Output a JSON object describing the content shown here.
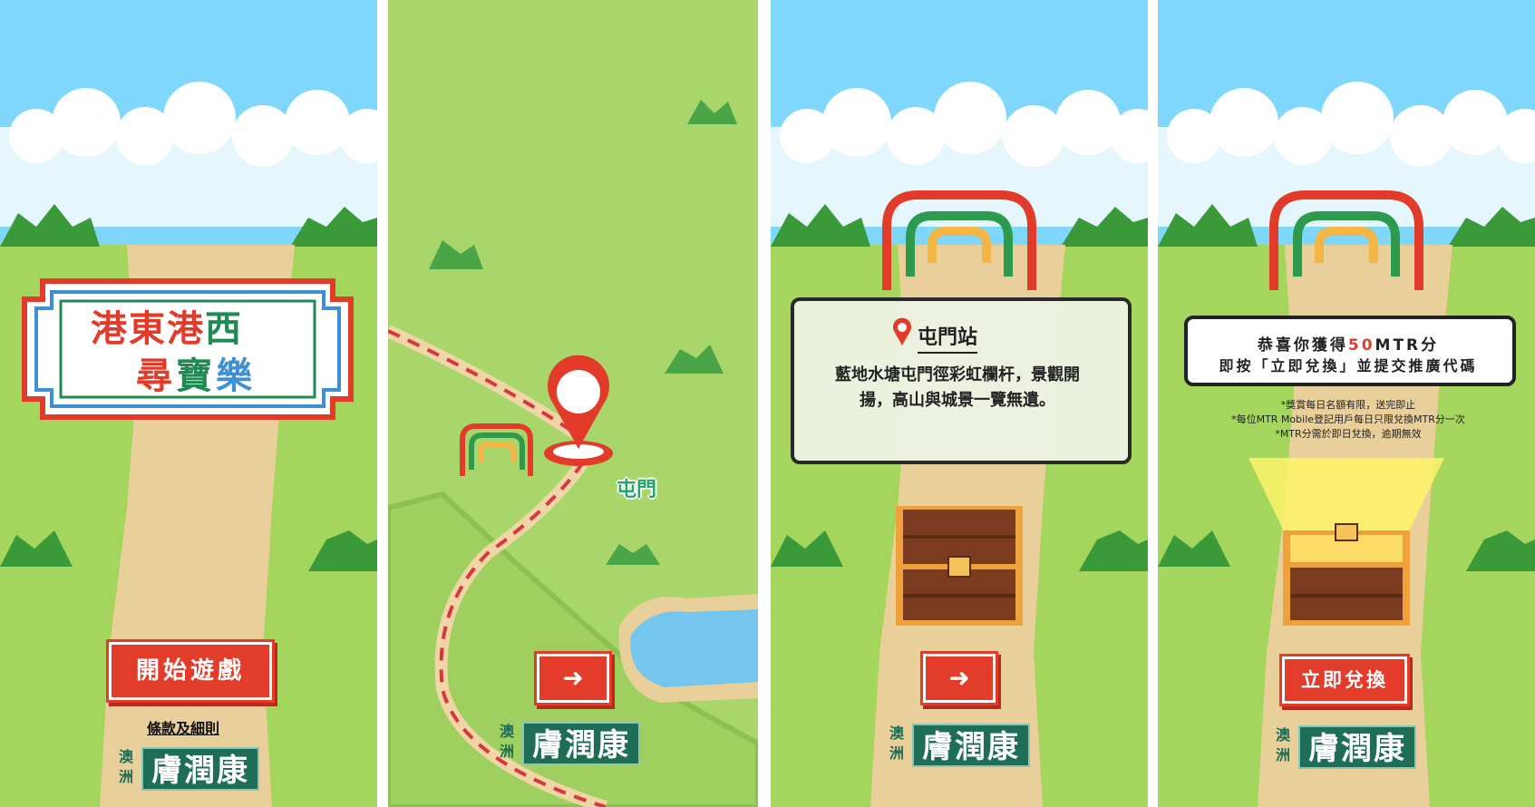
{
  "screens": {
    "start": {
      "title_line1": [
        "港",
        "東",
        "港",
        "西"
      ],
      "title_line2": [
        "尋",
        "寶",
        "樂"
      ],
      "start_button": "開始遊戲",
      "terms_link": "條款及細則"
    },
    "map": {
      "station_label": "屯門",
      "next_icon": "arrow-right-icon"
    },
    "station": {
      "station_name": "屯門站",
      "description_line1": "藍地水塘屯門徑彩虹欄杆，景觀開",
      "description_line2": "揚，高山與城景一覽無遺。",
      "next_icon": "arrow-right-icon"
    },
    "reward": {
      "congrats_prefix": "恭喜你獲得",
      "points": "50",
      "points_unit": "MTR分",
      "instruction": "即按「立即兌換」並提交推廣代碼",
      "note1": "*獎賞每日名額有限，送完即止",
      "note2": "*每位MTR Mobile登記用戶每日只限兌換MTR分一次",
      "note3": "*MTR分需於即日兌換，逾期無效",
      "redeem_button": "立即兌換"
    }
  },
  "sponsor": {
    "small_text": [
      "澳",
      "洲"
    ],
    "brand": "膚潤康"
  },
  "colors": {
    "sky": "#7fd7fb",
    "grass": "#a4d65e",
    "path": "#e9cf9a",
    "red": "#e43c2b",
    "green": "#1f8a52",
    "brand_green": "#1e6d57"
  }
}
